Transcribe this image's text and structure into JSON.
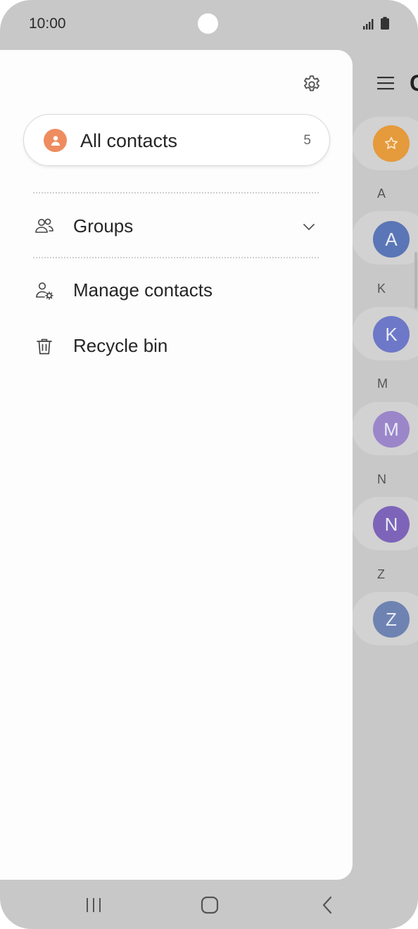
{
  "status_bar": {
    "time": "10:00"
  },
  "background_list": {
    "title_partial": "C",
    "sections": [
      {
        "letter": "A",
        "avatar": "A",
        "color": "#5b76b6"
      },
      {
        "letter": "K",
        "avatar": "K",
        "color": "#6e78c8"
      },
      {
        "letter": "M",
        "avatar": "M",
        "color": "#9b86c9"
      },
      {
        "letter": "N",
        "avatar": "N",
        "color": "#7d64b8"
      },
      {
        "letter": "Z",
        "avatar": "Z",
        "color": "#6f83b2"
      }
    ],
    "favorites_color": "#e59a3c"
  },
  "drawer": {
    "all_contacts": {
      "label": "All contacts",
      "count": "5",
      "icon": "person-icon",
      "icon_color": "#ee8c5f"
    },
    "groups": {
      "label": "Groups",
      "icon": "groups-icon"
    },
    "manage_contacts": {
      "label": "Manage contacts",
      "icon": "manage-contacts-icon"
    },
    "recycle_bin": {
      "label": "Recycle bin",
      "icon": "trash-icon"
    }
  },
  "nav_bar": {
    "recents": "recents-icon",
    "home": "home-icon",
    "back": "back-icon"
  }
}
